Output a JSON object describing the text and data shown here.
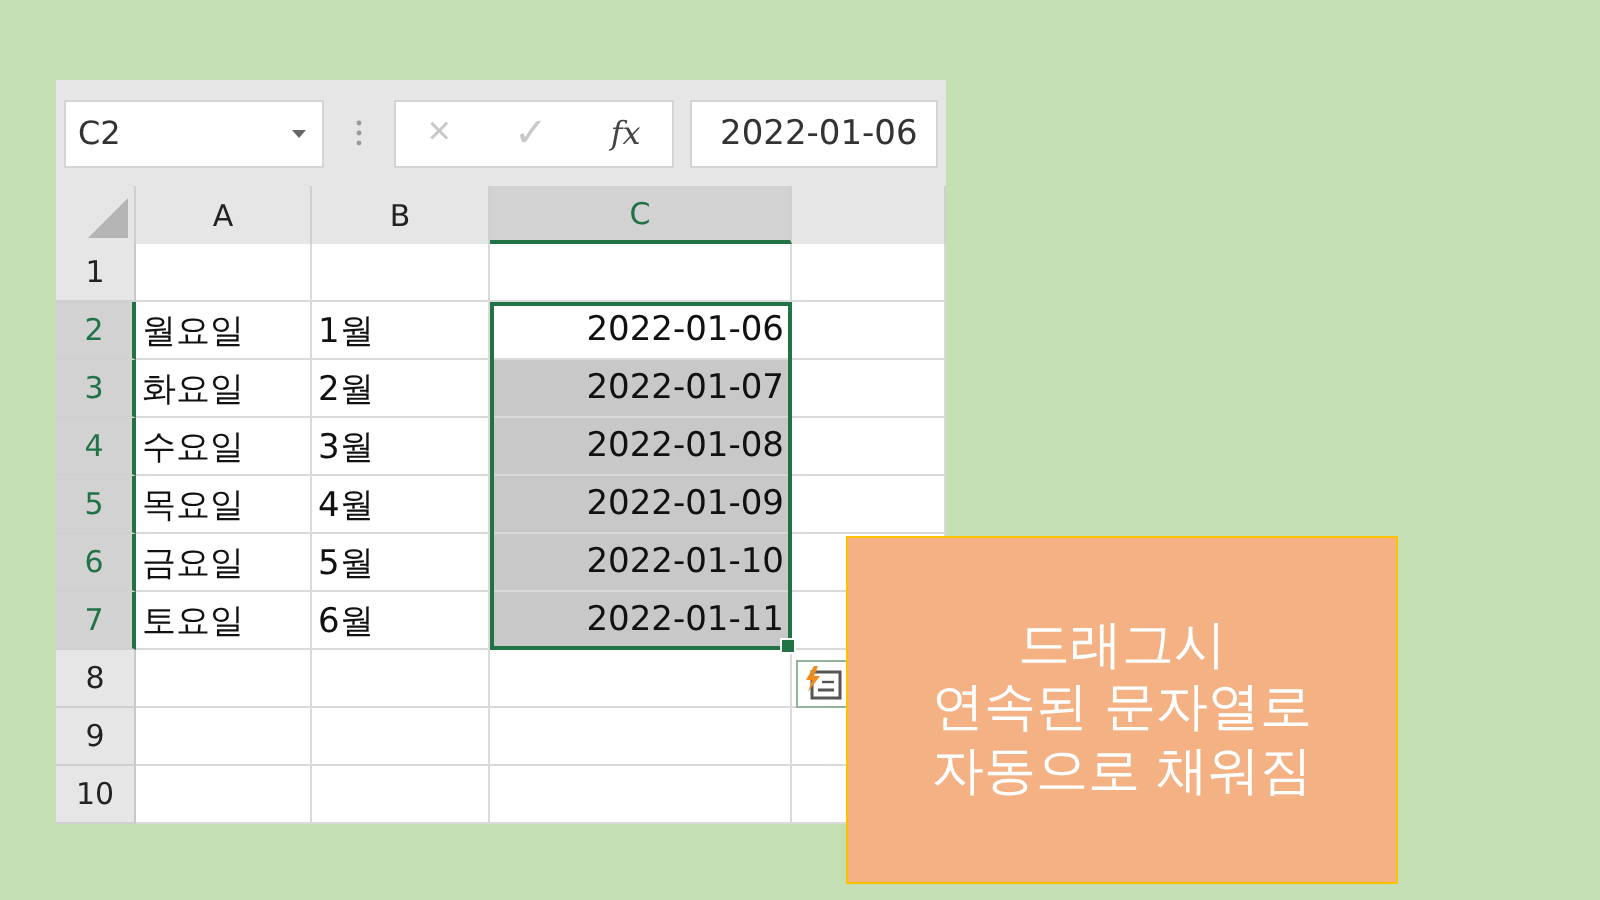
{
  "name_box": "C2",
  "formula_bar": {
    "cancel_icon": "×",
    "enter_icon": "✓",
    "function_icon": "fx",
    "value": "2022-01-06"
  },
  "columns": [
    {
      "label": "A",
      "selected": false
    },
    {
      "label": "B",
      "selected": false
    },
    {
      "label": "C",
      "selected": true
    }
  ],
  "rows": [
    {
      "number": "1",
      "selected": false
    },
    {
      "number": "2",
      "selected": true,
      "col_a": "월요일",
      "col_b": "1월",
      "col_c": "2022-01-06",
      "shaded": false
    },
    {
      "number": "3",
      "selected": true,
      "col_a": "화요일",
      "col_b": "2월",
      "col_c": "2022-01-07",
      "shaded": true
    },
    {
      "number": "4",
      "selected": true,
      "col_a": "수요일",
      "col_b": "3월",
      "col_c": "2022-01-08",
      "shaded": true
    },
    {
      "number": "5",
      "selected": true,
      "col_a": "목요일",
      "col_b": "4월",
      "col_c": "2022-01-09",
      "shaded": true
    },
    {
      "number": "6",
      "selected": true,
      "col_a": "금요일",
      "col_b": "5월",
      "col_c": "2022-01-10",
      "shaded": true
    },
    {
      "number": "7",
      "selected": true,
      "col_a": "토요일",
      "col_b": "6월",
      "col_c": "2022-01-11",
      "shaded": true
    },
    {
      "number": "8",
      "selected": false
    },
    {
      "number": "9",
      "selected": false
    },
    {
      "number": "10",
      "selected": false
    }
  ],
  "callout": {
    "lines": [
      "드래그시",
      "연속된 문자열로",
      "자동으로 채워짐"
    ]
  }
}
